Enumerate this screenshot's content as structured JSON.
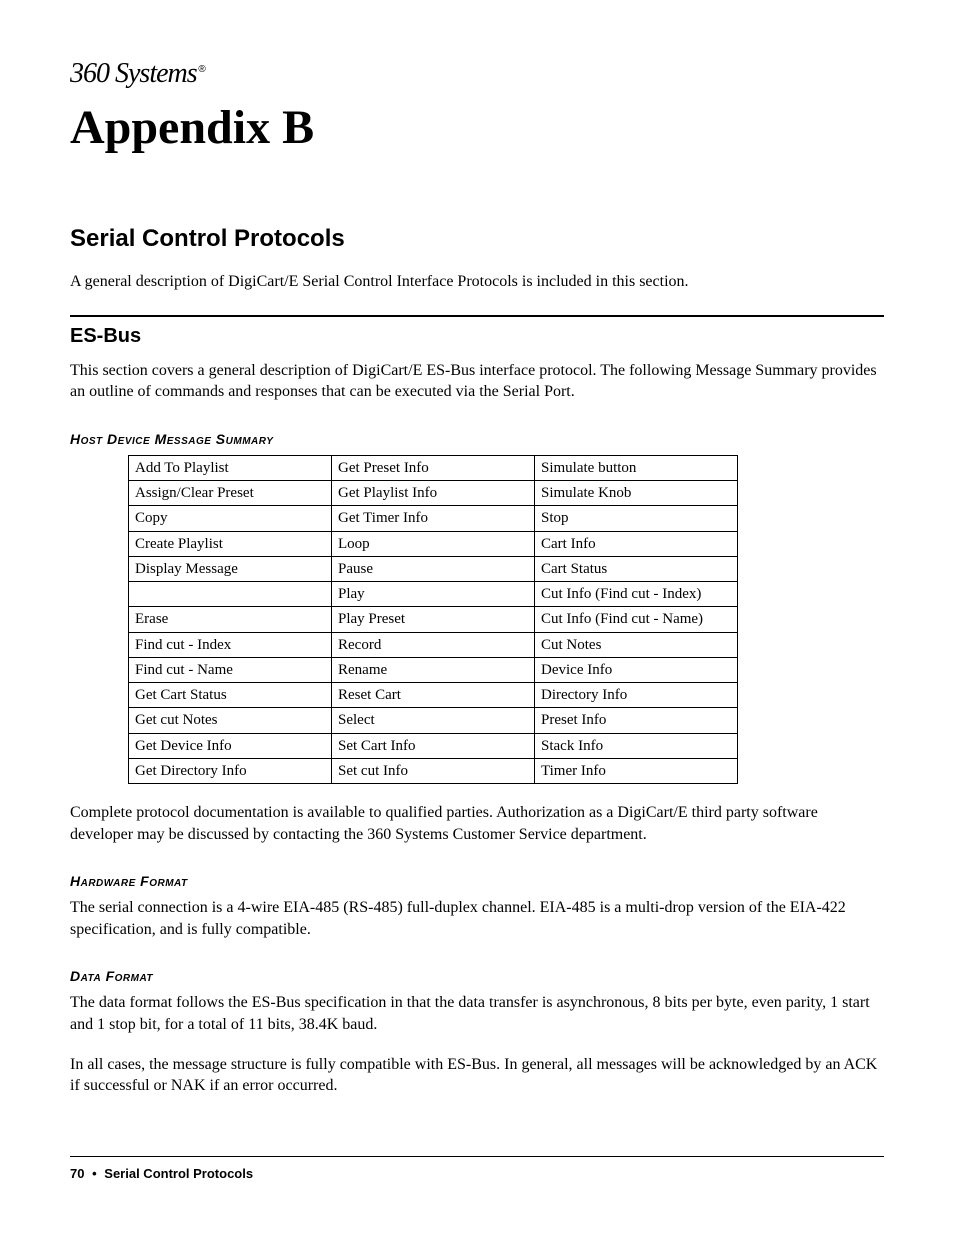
{
  "logo_text": "360 Systems",
  "title": "Appendix B",
  "section_heading": "Serial Control Protocols",
  "intro_para": "A general description of DigiCart/E Serial Control Interface Protocols is included in this section.",
  "esbus_heading": "ES-Bus",
  "esbus_para": "This section covers a general description of DigiCart/E ES-Bus interface protocol.  The following Message Summary provides an outline of commands and responses that can be executed via the Serial Port.",
  "host_summary_heading": "Host Device Message Summary",
  "table_rows": [
    [
      "Add To Playlist",
      "Get Preset Info",
      "Simulate button"
    ],
    [
      "Assign/Clear Preset",
      "Get Playlist Info",
      "Simulate Knob"
    ],
    [
      "Copy",
      "Get Timer Info",
      "Stop"
    ],
    [
      "Create Playlist",
      "Loop",
      "Cart Info"
    ],
    [
      "Display Message",
      "Pause",
      "Cart Status"
    ],
    [
      "",
      "Play",
      "Cut Info (Find cut - Index)"
    ],
    [
      "Erase",
      "Play Preset",
      "Cut Info (Find cut - Name)"
    ],
    [
      "Find cut - Index",
      "Record",
      "Cut Notes"
    ],
    [
      "Find cut - Name",
      "Rename",
      "Device Info"
    ],
    [
      "Get Cart Status",
      "Reset Cart",
      "Directory Info"
    ],
    [
      "Get cut Notes",
      "Select",
      "Preset Info"
    ],
    [
      "Get Device Info",
      "Set Cart Info",
      "Stack Info"
    ],
    [
      "Get Directory Info",
      "Set cut Info",
      "Timer Info"
    ]
  ],
  "protocol_para": "Complete protocol documentation is available to qualified parties.  Authorization as a DigiCart/E third party software developer may be discussed by contacting the 360 Systems Customer Service department.",
  "hardware_heading": "Hardware Format",
  "hardware_para": "The serial connection is a 4-wire EIA-485 (RS-485) full-duplex channel.  EIA-485 is a multi-drop version of the EIA-422 specification, and is fully compatible.",
  "data_heading": "Data Format",
  "data_para1": "The data format follows the ES-Bus specification in that the data transfer is asynchronous, 8 bits per byte, even parity, 1 start and 1 stop bit, for a total of 11 bits, 38.4K baud.",
  "data_para2": "In all cases, the message structure is fully compatible with ES-Bus.  In general, all messages will be acknowledged by an ACK if successful or NAK if an error occurred.",
  "footer_page": "70",
  "footer_bullet": "•",
  "footer_title": "Serial Control Protocols"
}
